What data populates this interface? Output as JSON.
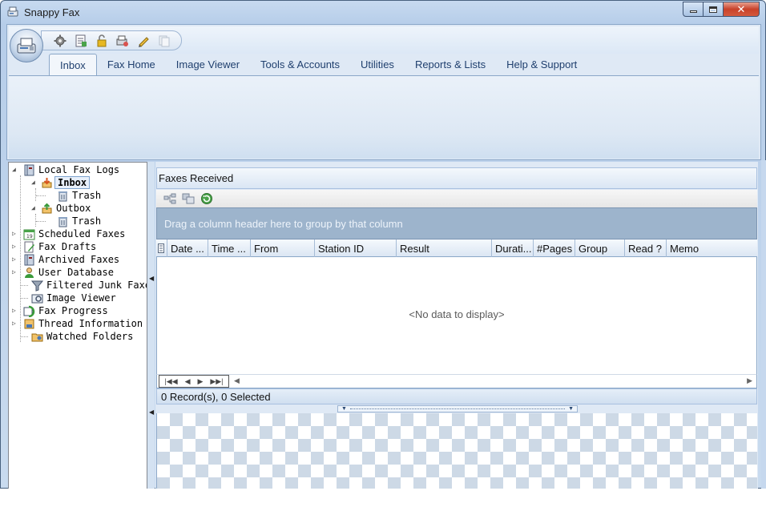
{
  "window": {
    "title": "Snappy Fax"
  },
  "ribbon": {
    "tabs": [
      {
        "label": "Inbox",
        "active": true
      },
      {
        "label": "Fax Home",
        "active": false
      },
      {
        "label": "Image Viewer",
        "active": false
      },
      {
        "label": "Tools & Accounts",
        "active": false
      },
      {
        "label": "Utilities",
        "active": false
      },
      {
        "label": "Reports & Lists",
        "active": false
      },
      {
        "label": "Help & Support",
        "active": false
      }
    ],
    "quick_access_icons": [
      "gear-icon",
      "document-list-icon",
      "lock-icon",
      "fax-settings-icon",
      "pencil-icon",
      "disabled-copy-icon"
    ]
  },
  "tree": {
    "items": [
      {
        "label": "Local Fax Logs",
        "icon": "log-book-icon"
      },
      {
        "label": "Inbox",
        "icon": "inbox-icon",
        "selected": true
      },
      {
        "label": "Trash",
        "icon": "trash-icon"
      },
      {
        "label": "Outbox",
        "icon": "outbox-icon"
      },
      {
        "label": "Trash",
        "icon": "trash-icon"
      },
      {
        "label": "Scheduled Faxes",
        "icon": "calendar-icon"
      },
      {
        "label": "Fax Drafts",
        "icon": "draft-icon"
      },
      {
        "label": "Archived Faxes",
        "icon": "archive-icon"
      },
      {
        "label": "User Database",
        "icon": "user-icon"
      },
      {
        "label": "Filtered Junk Faxes",
        "icon": "filter-icon"
      },
      {
        "label": "Image Viewer",
        "icon": "image-viewer-icon"
      },
      {
        "label": "Fax Progress",
        "icon": "progress-icon"
      },
      {
        "label": "Thread Information",
        "icon": "thread-icon"
      },
      {
        "label": "Watched Folders",
        "icon": "folder-icon"
      }
    ]
  },
  "grid": {
    "title": "Faxes Received",
    "group_hint": "Drag a column header here to group by that column",
    "columns": [
      "Date ...",
      "Time ...",
      "From",
      "Station ID",
      "Result",
      "Durati...",
      "#Pages",
      "Group",
      "Read ?",
      "Memo"
    ],
    "empty_text": "<No data to display>",
    "status": "0 Record(s), 0 Selected"
  },
  "colors": {
    "accent": "#1f3f6e",
    "group_bar": "#9db4cc",
    "ribbon_bg": "#dfe9f5",
    "close_button": "#c8412a"
  }
}
